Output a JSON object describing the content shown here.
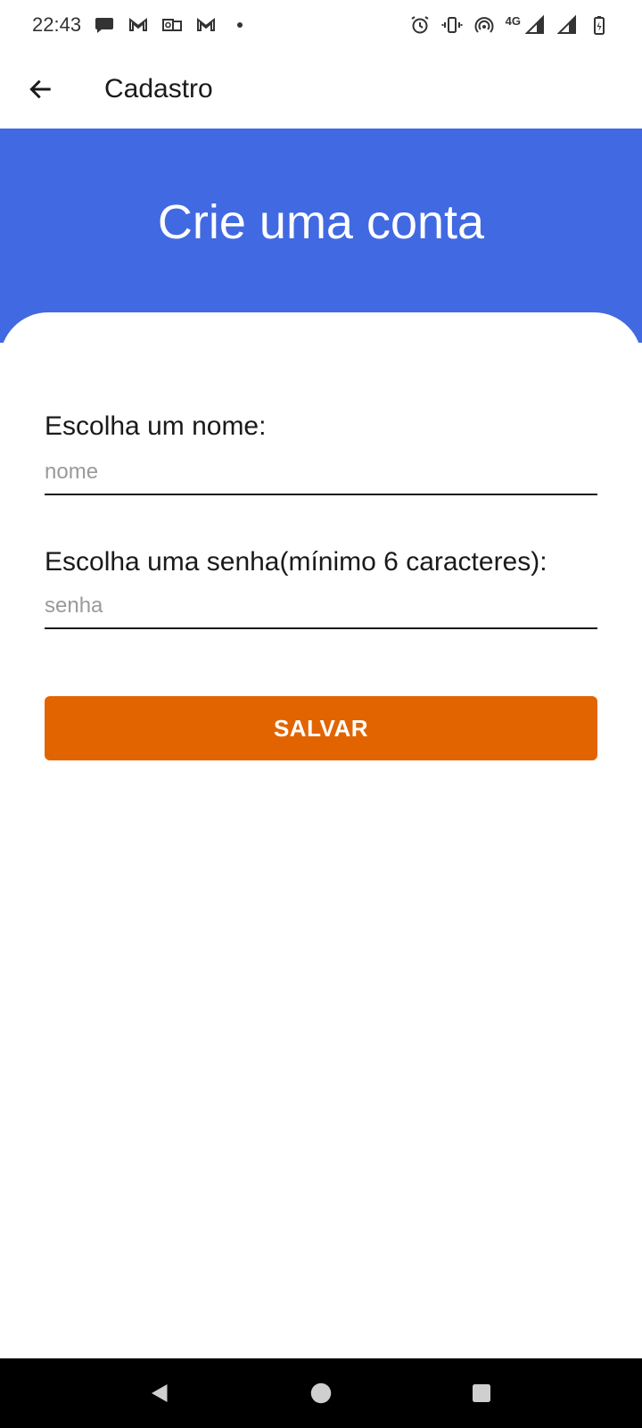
{
  "status_bar": {
    "time": "22:43",
    "notification_icons": [
      "chat-bubble-icon",
      "gmail-icon",
      "outlook-icon",
      "gmail-icon",
      "dot-icon"
    ],
    "system_icons": [
      "alarm-icon",
      "vibrate-icon",
      "hotspot-icon",
      "signal-icon",
      "signal-icon",
      "battery-icon"
    ],
    "network_label": "4G"
  },
  "app_bar": {
    "title": "Cadastro",
    "back_icon": "arrow-left-icon"
  },
  "header": {
    "title": "Crie uma conta",
    "background_color": "#4169e1"
  },
  "form": {
    "name_label": "Escolha um nome:",
    "name_placeholder": "nome",
    "name_value": "",
    "password_label": "Escolha uma senha(mínimo 6 caracteres):",
    "password_placeholder": "senha",
    "password_value": "",
    "save_label": "SALVAR",
    "save_color": "#e26400"
  },
  "nav_bar": {
    "buttons": [
      "back-triangle-icon",
      "home-circle-icon",
      "recents-square-icon"
    ]
  }
}
